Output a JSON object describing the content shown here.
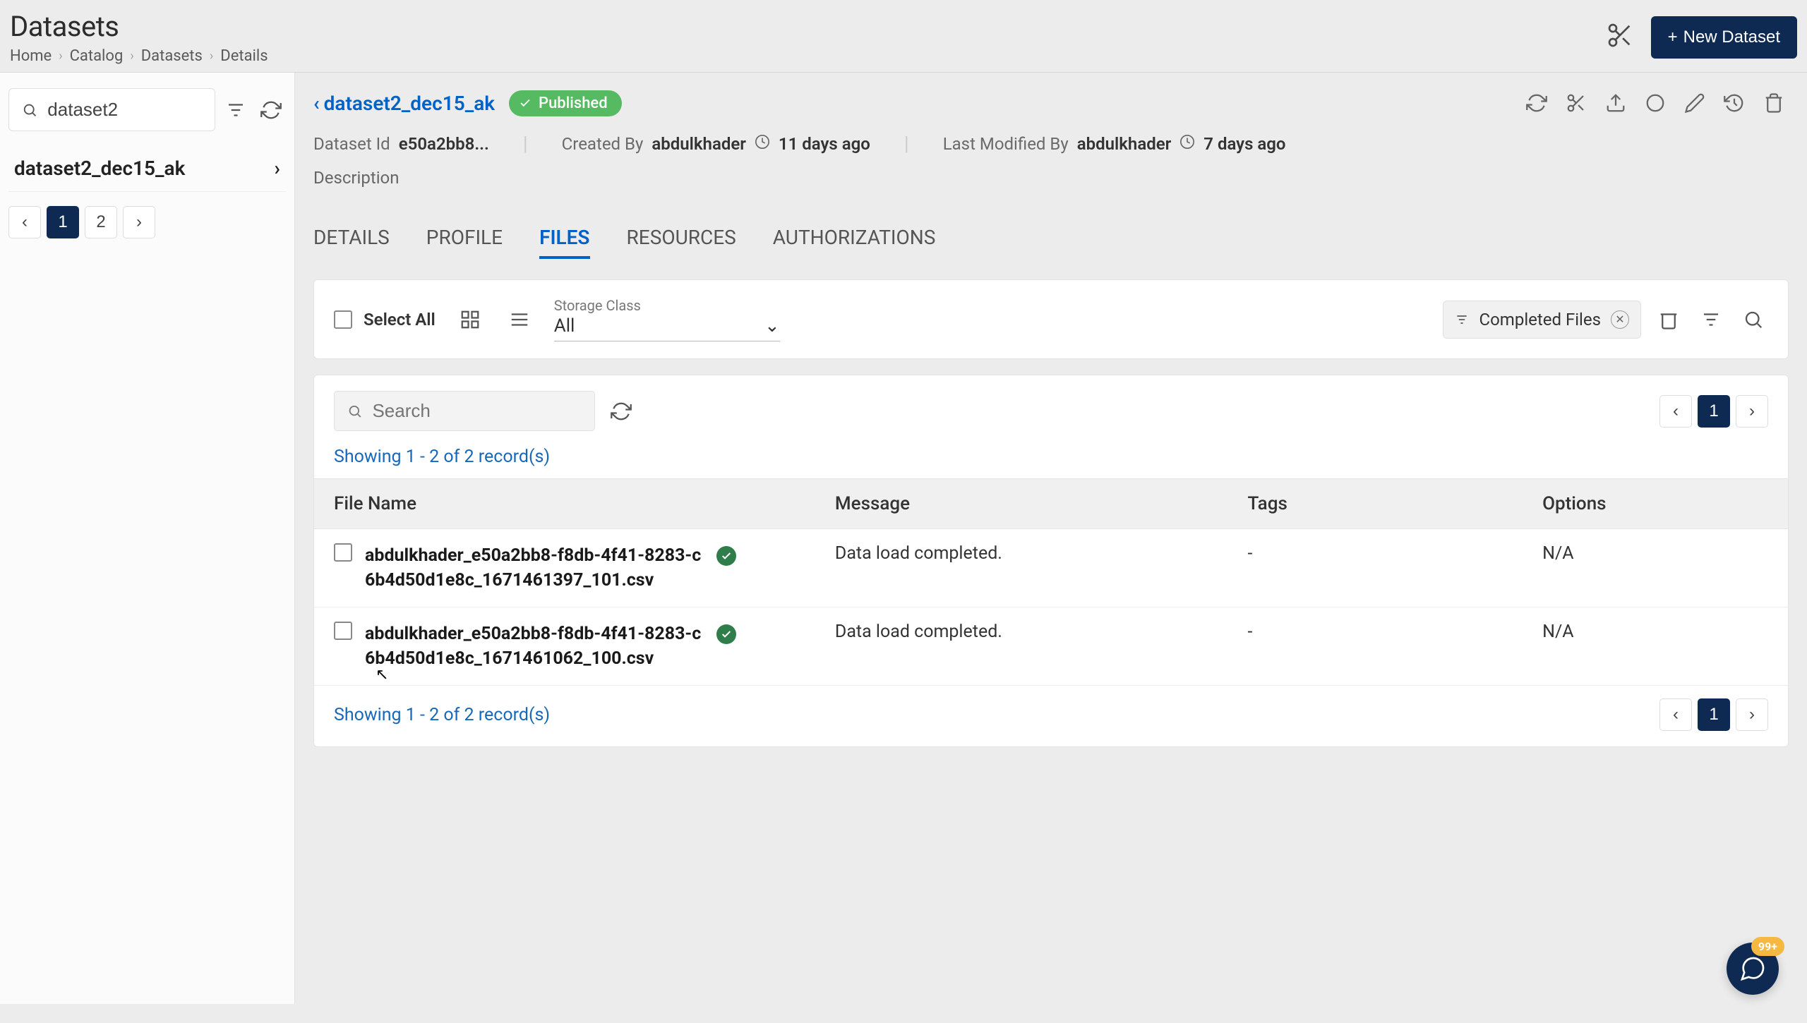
{
  "header": {
    "page_title": "Datasets",
    "breadcrumbs": [
      "Home",
      "Catalog",
      "Datasets",
      "Details"
    ],
    "new_button": "New Dataset"
  },
  "sidebar": {
    "search_value": "dataset2",
    "items": [
      "dataset2_dec15_ak"
    ],
    "pages": [
      "1",
      "2"
    ],
    "active_page": "1"
  },
  "dataset": {
    "name": "dataset2_dec15_ak",
    "status": "Published",
    "id_label": "Dataset Id",
    "id_value": "e50a2bb8...",
    "created_by_label": "Created By",
    "created_by_value": "abdulkhader",
    "created_age": "11 days ago",
    "modified_by_label": "Last Modified By",
    "modified_by_value": "abdulkhader",
    "modified_age": "7 days ago",
    "description_label": "Description"
  },
  "tabs": [
    "DETAILS",
    "PROFILE",
    "FILES",
    "RESOURCES",
    "AUTHORIZATIONS"
  ],
  "active_tab": "FILES",
  "toolbar": {
    "select_all": "Select All",
    "storage_label": "Storage Class",
    "storage_value": "All",
    "filter_chip": "Completed Files"
  },
  "files": {
    "search_placeholder": "Search",
    "records_text": "Showing 1 - 2 of 2 record(s)",
    "columns": [
      "File Name",
      "Message",
      "Tags",
      "Options"
    ],
    "rows": [
      {
        "file": "abdulkhader_e50a2bb8-f8db-4f41-8283-c6b4d50d1e8c_1671461397_101.csv",
        "message": "Data load completed.",
        "tags": "-",
        "options": "N/A"
      },
      {
        "file": "abdulkhader_e50a2bb8-f8db-4f41-8283-c6b4d50d1e8c_1671461062_100.csv",
        "message": "Data load completed.",
        "tags": "-",
        "options": "N/A"
      }
    ],
    "page_current": "1"
  },
  "fab": {
    "badge": "99+"
  }
}
